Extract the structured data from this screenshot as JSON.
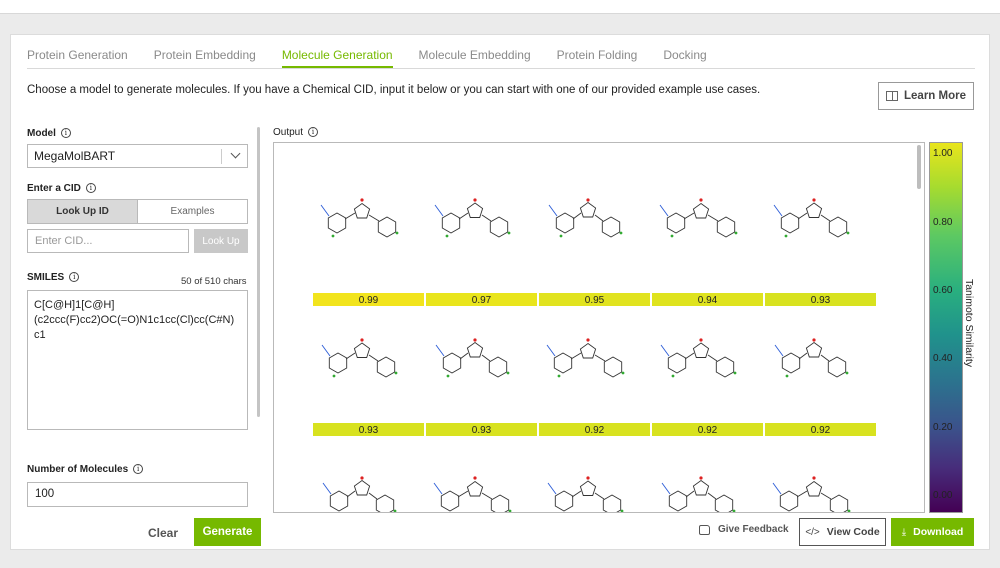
{
  "tabs": [
    "Protein Generation",
    "Protein Embedding",
    "Molecule Generation",
    "Molecule Embedding",
    "Protein Folding",
    "Docking"
  ],
  "intro": "Choose a model to generate molecules. If you have a Chemical CID, input it below or you can start with one of our provided example use cases.",
  "learn_more": "Learn More",
  "model": {
    "label": "Model",
    "value": "MegaMolBART"
  },
  "cid": {
    "label": "Enter a CID",
    "seg_lookup": "Look Up ID",
    "seg_examples": "Examples",
    "placeholder": "Enter CID...",
    "button": "Look Up"
  },
  "smiles": {
    "label": "SMILES",
    "chars": "50 of 510 chars",
    "value": "C[C@H]1[C@H]\n(c2ccc(F)cc2)OC(=O)N1c1cc(Cl)cc(C#N)\nc1"
  },
  "num_molecules": {
    "label": "Number of Molecules",
    "value": "100"
  },
  "buttons": {
    "clear": "Clear",
    "generate": "Generate",
    "feedback": "Give Feedback",
    "view_code": "View Code",
    "download": "Download"
  },
  "output": {
    "label": "Output"
  },
  "colorbar": {
    "label": "Tanimoto Similarity",
    "ticks": [
      "1.00",
      "0.80",
      "0.60",
      "0.40",
      "0.20",
      "0.00"
    ]
  },
  "scores": [
    [
      "0.99",
      "0.97",
      "0.95",
      "0.94",
      "0.93"
    ],
    [
      "0.93",
      "0.93",
      "0.92",
      "0.92",
      "0.92"
    ]
  ],
  "colors": {
    "accent": "#76b900",
    "score_row1": [
      "#f2e41d",
      "#e9e51c",
      "#e1e31f",
      "#dfe31e",
      "#d8e21f"
    ],
    "score_row2": "#d8e21f"
  }
}
